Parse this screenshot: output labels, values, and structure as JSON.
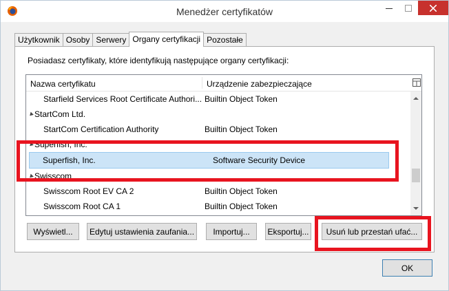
{
  "window": {
    "title": "Menedżer certyfikatów"
  },
  "tabs": [
    {
      "label": "Użytkownik"
    },
    {
      "label": "Osoby"
    },
    {
      "label": "Serwery"
    },
    {
      "label": "Organy certyfikacji"
    },
    {
      "label": "Pozostałe"
    }
  ],
  "active_tab": "Organy certyfikacji",
  "intro_text": "Posiadasz certyfikaty, które identyfikują następujące organy certyfikacji:",
  "tree": {
    "columns": {
      "name": "Nazwa certyfikatu",
      "device": "Urządzenie zabezpieczające"
    },
    "rows": [
      {
        "type": "leaf",
        "name": "Starfield Services Root Certificate Authori...",
        "device": "Builtin Object Token"
      },
      {
        "type": "group",
        "name": "StartCom Ltd."
      },
      {
        "type": "leaf",
        "name": "StartCom Certification Authority",
        "device": "Builtin Object Token"
      },
      {
        "type": "group",
        "name": "Superfish, Inc."
      },
      {
        "type": "leaf",
        "name": "Superfish, Inc.",
        "device": "Software Security Device",
        "selected": true
      },
      {
        "type": "group",
        "name": "Swisscom"
      },
      {
        "type": "leaf",
        "name": "Swisscom Root EV CA 2",
        "device": "Builtin Object Token"
      },
      {
        "type": "leaf",
        "name": "Swisscom Root CA 1",
        "device": "Builtin Object Token"
      }
    ]
  },
  "buttons": {
    "view": "Wyświetl...",
    "edit_trust": "Edytuj ustawienia zaufania...",
    "import": "Importuj...",
    "export": "Eksportuj...",
    "delete": "Usuń lub przestań ufać...",
    "ok": "OK"
  },
  "colors": {
    "highlight_box": "#e8141f",
    "selection": "#cce4f7",
    "close_button": "#c7312d"
  }
}
